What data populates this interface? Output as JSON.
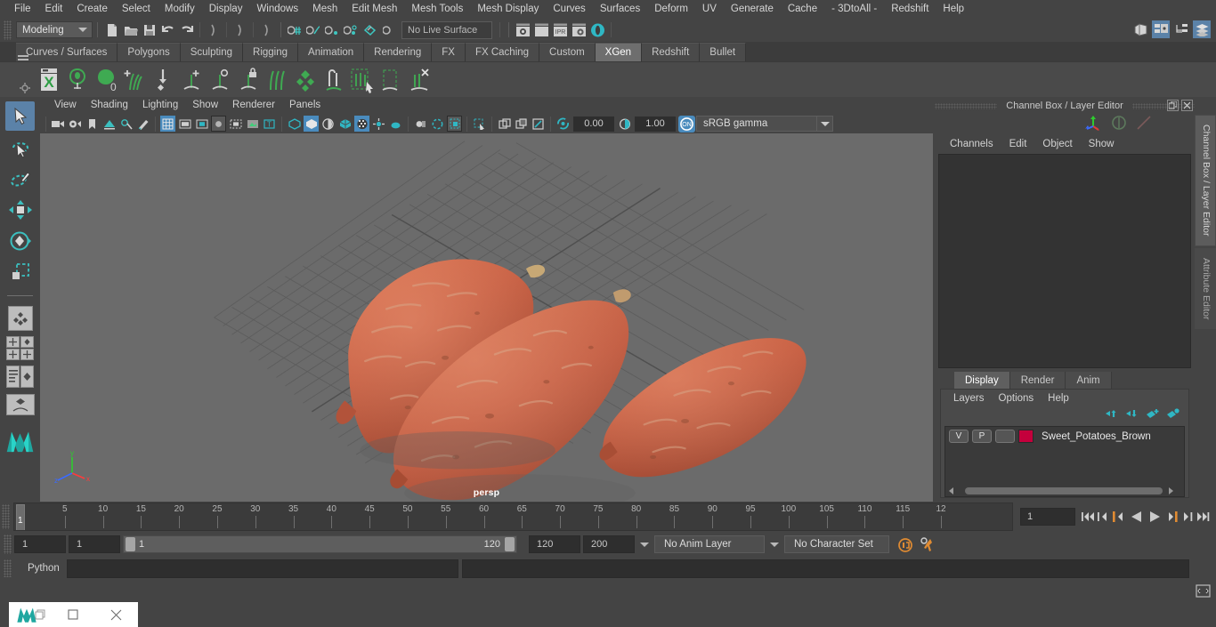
{
  "app": {
    "title": "Autodesk Maya",
    "menus": [
      "File",
      "Edit",
      "Create",
      "Select",
      "Modify",
      "Display",
      "Windows",
      "Mesh",
      "Edit Mesh",
      "Mesh Tools",
      "Mesh Display",
      "Curves",
      "Surfaces",
      "Deform",
      "UV",
      "Generate",
      "Cache",
      "- 3DtoAll -",
      "Redshift",
      "Help"
    ]
  },
  "status_line": {
    "menuset": "Modeling",
    "live_surface": "No Live Surface",
    "icons": [
      "new-scene-icon",
      "open-scene-icon",
      "save-scene-icon",
      "undo-icon",
      "redo-icon",
      "select-by-hierarchy-icon",
      "select-by-object-icon",
      "select-by-component-icon",
      "snap-to-grid-icon",
      "snap-to-curve-icon",
      "snap-to-point-icon",
      "snap-to-projected-center-icon",
      "snap-to-view-plane-icon",
      "make-live-icon",
      "render-current-frame-icon",
      "ipr-render-icon",
      "render-settings-icon",
      "hypershade-icon"
    ],
    "layout_icons": [
      "show-hide-ui-icon",
      "outliner-layout-icon",
      "hypergraph-layout-icon",
      "channelbox-layout-icon"
    ]
  },
  "shelf": {
    "tabs": [
      "Curves / Surfaces",
      "Polygons",
      "Sculpting",
      "Rigging",
      "Animation",
      "Rendering",
      "FX",
      "FX Caching",
      "Custom",
      "XGen",
      "Redshift",
      "Bullet"
    ],
    "active_tab": "XGen",
    "buttons": [
      "xgen-editor-icon",
      "xgen-preview-icon",
      "xgen-fill-icon",
      "xgen-add-guides-icon",
      "xgen-place-guide-icon",
      "xgen-add-length-icon",
      "xgen-add-width-icon",
      "xgen-lock-guide-icon",
      "xgen-comb-icon",
      "xgen-density-icon",
      "xgen-sculpt-icon",
      "xgen-select-guides-icon",
      "xgen-clump-icon",
      "xgen-delete-guides-icon"
    ]
  },
  "toolbox": {
    "items": [
      "select-tool-icon",
      "lasso-select-tool-icon",
      "paint-select-tool-icon",
      "move-tool-icon",
      "rotate-tool-icon",
      "scale-tool-icon",
      "show-manipulator-tool-icon",
      "last-tool-icon"
    ],
    "active": "select-tool-icon",
    "layout_presets": [
      "single-pane-layout-icon",
      "four-pane-layout-icon",
      "outliner-persp-layout-icon",
      "persp-graph-layout-icon"
    ],
    "logo": "maya-logo-icon"
  },
  "viewport": {
    "menus": [
      "View",
      "Shading",
      "Lighting",
      "Show",
      "Renderer",
      "Panels"
    ],
    "camera_label": "persp",
    "exposure": "0.00",
    "gamma": "1.00",
    "color_management": "sRGB gamma",
    "toolbar_icons": [
      "select-camera-icon",
      "camera-attributes-icon",
      "bookmark-icon",
      "image-plane-icon",
      "two-d-pan-zoom-icon",
      "grease-pencil-icon",
      "grid-toggle-icon",
      "film-gate-icon",
      "resolution-gate-icon",
      "gate-mask-icon",
      "film-origin-icon",
      "xray-joints-icon",
      "texture-toggle-icon",
      "wireframe-icon",
      "smooth-shade-all-icon",
      "shaded-wireframe-icon",
      "textured-icon",
      "lighting-icon",
      "shadows-icon",
      "screen-space-ao-icon",
      "motion-blur-icon",
      "multisample-aa-icon",
      "depth-of-field-icon",
      "isolate-select-icon",
      "display-layer-icon",
      "xray-icon",
      "xray-active-icon",
      "exposure-icon",
      "gamma-icon",
      "color-management-toggle-icon"
    ],
    "axis_gizmo": {
      "x": "x",
      "y": "y",
      "z": "z"
    },
    "scene_objects": "three sweet potatoes on ground grid"
  },
  "channel_box": {
    "panel_title": "Channel Box / Layer Editor",
    "menus": [
      "Channels",
      "Edit",
      "Object",
      "Show"
    ],
    "header_icons": [
      "move-axis-icon",
      "rotate-handle-icon",
      "scale-handle-icon"
    ],
    "window_buttons": [
      "undock-icon",
      "close-icon"
    ]
  },
  "layer_editor": {
    "tabs": [
      "Display",
      "Render",
      "Anim"
    ],
    "active_tab": "Display",
    "menus": [
      "Layers",
      "Options",
      "Help"
    ],
    "toolbar_icons": [
      "move-layer-up-icon",
      "move-layer-down-icon",
      "new-layer-icon",
      "new-layer-from-selected-icon"
    ],
    "layers": [
      {
        "visibility": "V",
        "playback": "P",
        "shading": "",
        "color": "#c4003c",
        "name": "Sweet_Potatoes_Brown"
      }
    ]
  },
  "vertical_tabs": [
    "Channel Box / Layer Editor",
    "Attribute Editor"
  ],
  "time_slider": {
    "current_frame": "1",
    "ticks": [
      "5",
      "10",
      "15",
      "20",
      "25",
      "30",
      "35",
      "40",
      "45",
      "50",
      "55",
      "60",
      "65",
      "70",
      "75",
      "80",
      "85",
      "90",
      "95",
      "100",
      "105",
      "110",
      "115",
      "12"
    ],
    "frame_field": "1",
    "playback_buttons": [
      "go-to-start-icon",
      "step-back-keyframe-icon",
      "step-back-frame-icon",
      "play-backwards-icon",
      "play-forwards-icon",
      "step-forward-frame-icon",
      "step-forward-keyframe-icon",
      "go-to-end-icon"
    ]
  },
  "range_slider": {
    "start_field": "1",
    "range_start_field": "1",
    "range_start_label": "1",
    "range_end_label": "120",
    "range_end_field": "120",
    "end_field": "200",
    "anim_layer": "No Anim Layer",
    "character_set": "No Character Set",
    "right_icons": [
      "auto-key-icon",
      "animation-preferences-icon"
    ]
  },
  "command_line": {
    "language": "Python",
    "input_value": "",
    "script-editor-icon": "script-editor-icon"
  },
  "taskbar": {
    "items": [
      "maya-app-icon",
      "restore-window-icon",
      "close-window-icon"
    ]
  }
}
